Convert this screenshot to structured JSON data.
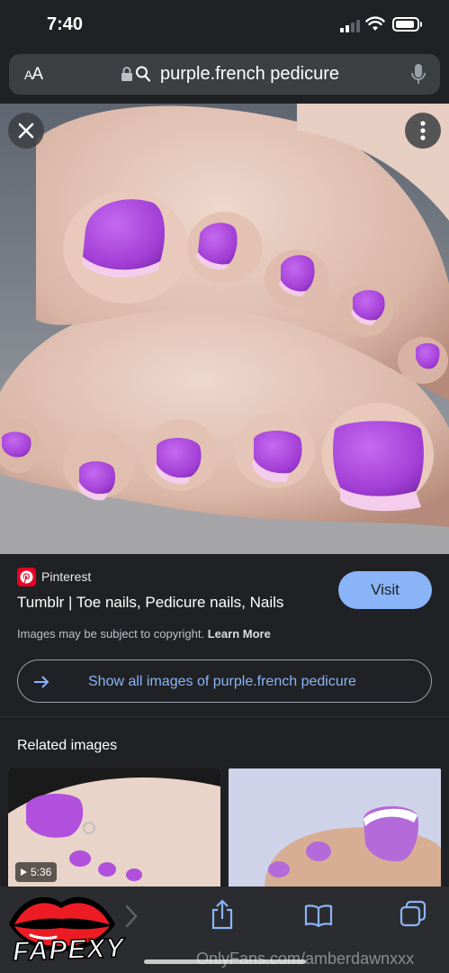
{
  "status_bar": {
    "time": "7:40"
  },
  "address_bar": {
    "text_size_label": "AA",
    "url_text": "purple.french pedicure"
  },
  "image_viewer": {
    "subject": "purple french pedicure toes"
  },
  "result": {
    "source": "Pinterest",
    "title": "Tumblr | Toe nails, Pedicure nails, Nails",
    "visit_label": "Visit",
    "copyright_text": "Images may be subject to copyright.",
    "learn_more_label": "Learn More",
    "show_all_label": "Show all images of purple.french pedicure"
  },
  "related": {
    "heading": "Related images",
    "items": [
      {
        "duration": "5:36"
      },
      {
        "duration": ""
      }
    ]
  },
  "overlay": {
    "watermark": "OnlyFans.com/amberdawnxxx",
    "logo_text": "FAPEXY"
  },
  "colors": {
    "accent": "#8ab4f8",
    "background": "#202124",
    "nail_purple": "#a33fd6",
    "pinterest_red": "#e60023"
  }
}
